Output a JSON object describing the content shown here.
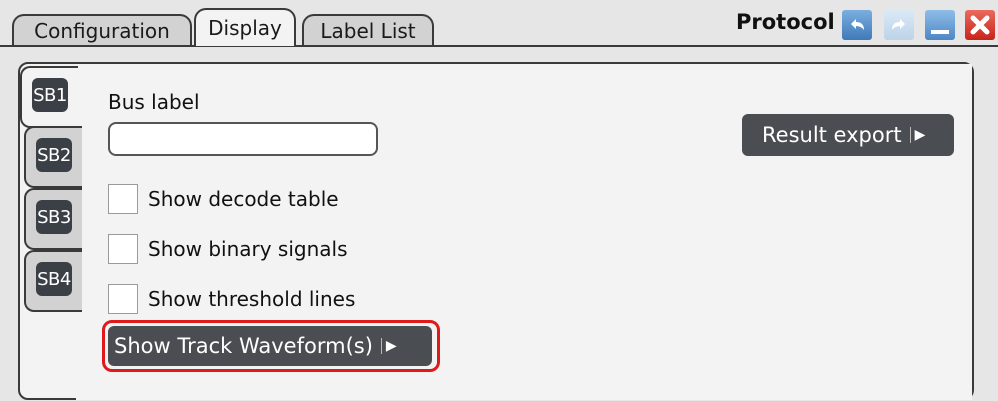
{
  "tabs": [
    {
      "label": "Configuration"
    },
    {
      "label": "Display"
    },
    {
      "label": "Label List"
    }
  ],
  "header": {
    "title": "Protocol",
    "icons": [
      "undo-icon",
      "redo-icon",
      "minimize-icon",
      "close-icon"
    ]
  },
  "side_tabs": [
    {
      "label": "SB1"
    },
    {
      "label": "SB2"
    },
    {
      "label": "SB3"
    },
    {
      "label": "SB4"
    }
  ],
  "bus_label": {
    "label": "Bus label",
    "value": ""
  },
  "checkboxes": [
    {
      "label": "Show decode table",
      "checked": false
    },
    {
      "label": "Show binary signals",
      "checked": false
    },
    {
      "label": "Show threshold lines",
      "checked": false
    }
  ],
  "buttons": {
    "result_export": "Result export",
    "track_waveforms": "Show Track Waveform(s)"
  },
  "colors": {
    "highlight": "#e01a1a",
    "button_dark": "#4a4e53"
  }
}
